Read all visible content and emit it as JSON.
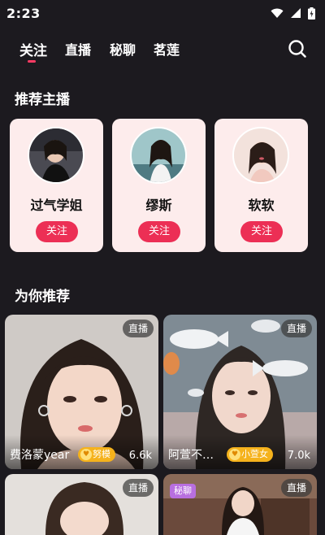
{
  "status_bar": {
    "time": "2:23",
    "icons": [
      "wifi-icon",
      "cellular-signal-icon",
      "battery-charging-icon"
    ]
  },
  "nav": {
    "tabs": [
      {
        "label": "关注",
        "active": true
      },
      {
        "label": "直播",
        "active": false
      },
      {
        "label": "秘聊",
        "active": false
      },
      {
        "label": "茗莲",
        "active": false
      }
    ],
    "search_icon": "search-icon",
    "accent_color": "#ff3b63"
  },
  "recommended_anchors": {
    "title": "推荐主播",
    "items": [
      {
        "name": "过气学姐",
        "follow_label": "关注"
      },
      {
        "name": "缪斯",
        "follow_label": "关注"
      },
      {
        "name": "软软",
        "follow_label": "关注"
      }
    ]
  },
  "for_you": {
    "title": "为你推荐",
    "cards": [
      {
        "name": "费洛蒙year",
        "badge": "努模",
        "viewers": "6.6k",
        "live_tag": "直播",
        "private_tag": ""
      },
      {
        "name": "阿萱不…",
        "badge": "小萱女",
        "viewers": "7.0k",
        "live_tag": "直播",
        "private_tag": ""
      },
      {
        "name": "",
        "badge": "",
        "viewers": "",
        "live_tag": "直播",
        "private_tag": ""
      },
      {
        "name": "",
        "badge": "",
        "viewers": "",
        "live_tag": "直播",
        "private_tag": "秘聊"
      }
    ]
  },
  "colors": {
    "background": "#1c1a1f",
    "card_background": "#fdecec",
    "follow_button": "#ec2f55",
    "badge": "#f5b21c"
  }
}
